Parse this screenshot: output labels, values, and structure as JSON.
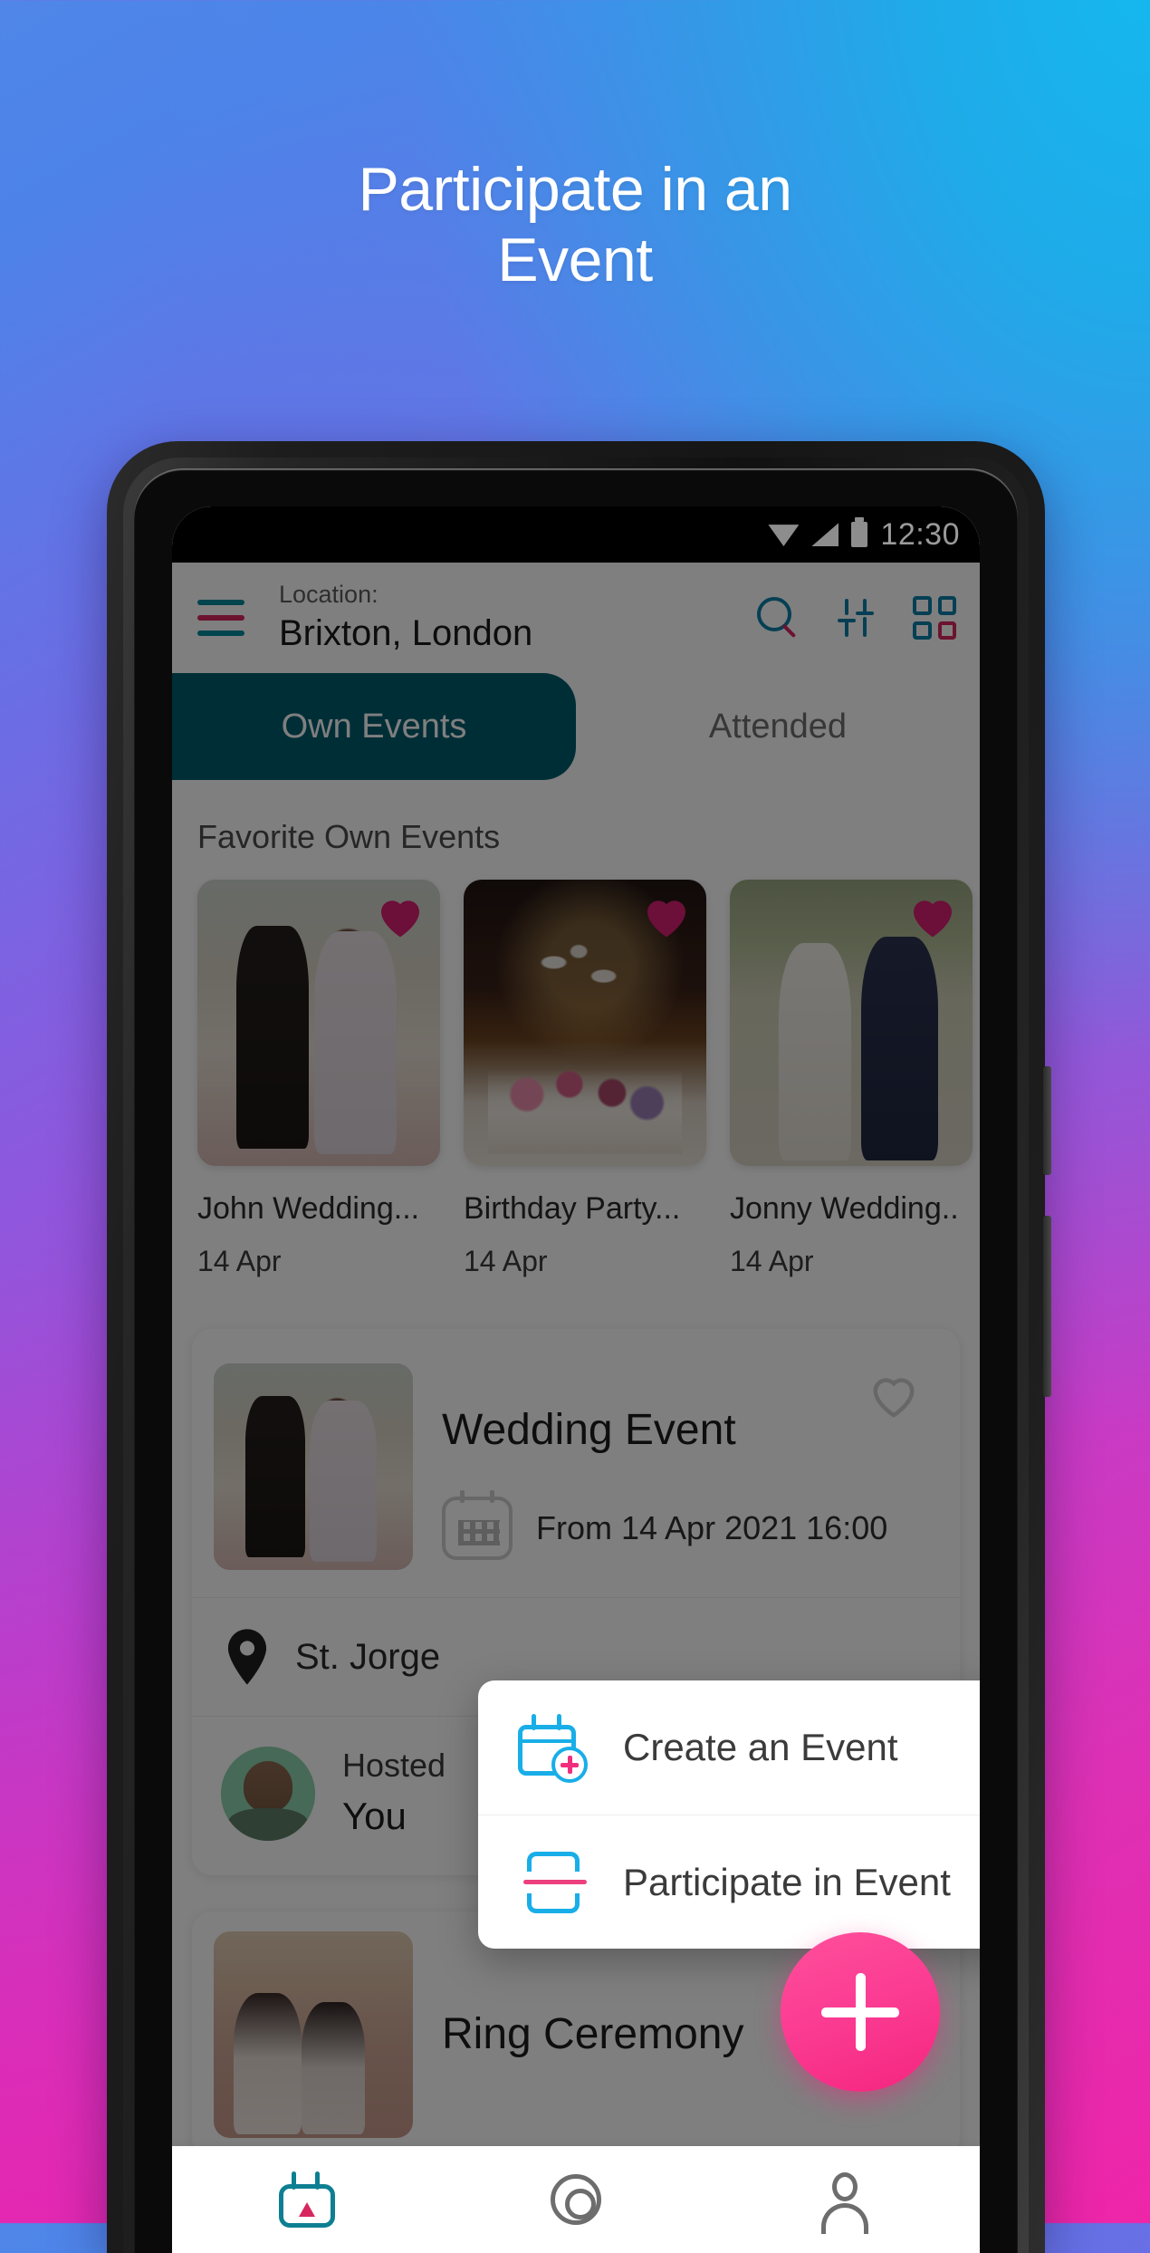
{
  "promo": {
    "line1": "Participate in an",
    "line2": "Event"
  },
  "status_bar": {
    "time": "12:30",
    "icons": [
      "wifi-icon",
      "signal-icon",
      "battery-icon"
    ]
  },
  "app_bar": {
    "menu_icon": "hamburger-menu-icon",
    "location_label": "Location:",
    "location_value": "Brixton, London",
    "actions": [
      {
        "icon": "search-icon"
      },
      {
        "icon": "filter-sliders-icon"
      },
      {
        "icon": "grid-view-icon"
      }
    ]
  },
  "tabs": [
    {
      "label": "Own Events",
      "active": true
    },
    {
      "label": "Attended",
      "active": false
    }
  ],
  "favorites": {
    "section_title": "Favorite Own Events",
    "items": [
      {
        "name": "John Wedding...",
        "date": "14 Apr",
        "favorite_icon": "heart-filled-icon"
      },
      {
        "name": "Birthday Party...",
        "date": "14 Apr",
        "favorite_icon": "heart-filled-icon"
      },
      {
        "name": "Jonny Wedding..",
        "date": "14 Apr",
        "favorite_icon": "heart-filled-icon"
      }
    ]
  },
  "event_card": {
    "title": "Wedding Event",
    "datetime": "From 14 Apr 2021  16:00",
    "calendar_icon": "calendar-icon",
    "favorite_icon": "heart-outline-icon",
    "location_icon": "map-pin-icon",
    "location": "St. Jorge",
    "host_label": "Hosted",
    "host_name": "You",
    "avatar_icon": "avatar"
  },
  "next_event_card": {
    "title": "Ring Ceremony"
  },
  "popup_menu": {
    "items": [
      {
        "label": "Create an Event",
        "icon": "calendar-plus-icon"
      },
      {
        "label": "Participate in Event",
        "icon": "scan-participate-icon"
      }
    ]
  },
  "fab": {
    "icon": "plus-icon"
  },
  "bottom_nav": [
    {
      "icon": "events-calendar-icon",
      "active": true
    },
    {
      "icon": "target-discover-icon",
      "active": false
    },
    {
      "icon": "profile-person-icon",
      "active": false
    }
  ],
  "colors": {
    "bg_gradient_start": "#22abe8",
    "bg_gradient_mid": "#8f57dd",
    "bg_gradient_end": "#ef25a8",
    "tab_active": "#015d6e",
    "accent_teal": "#0e7f92",
    "accent_blue": "#18aee8",
    "accent_pink": "#d7275f",
    "fab_pink": "#f5257f"
  }
}
